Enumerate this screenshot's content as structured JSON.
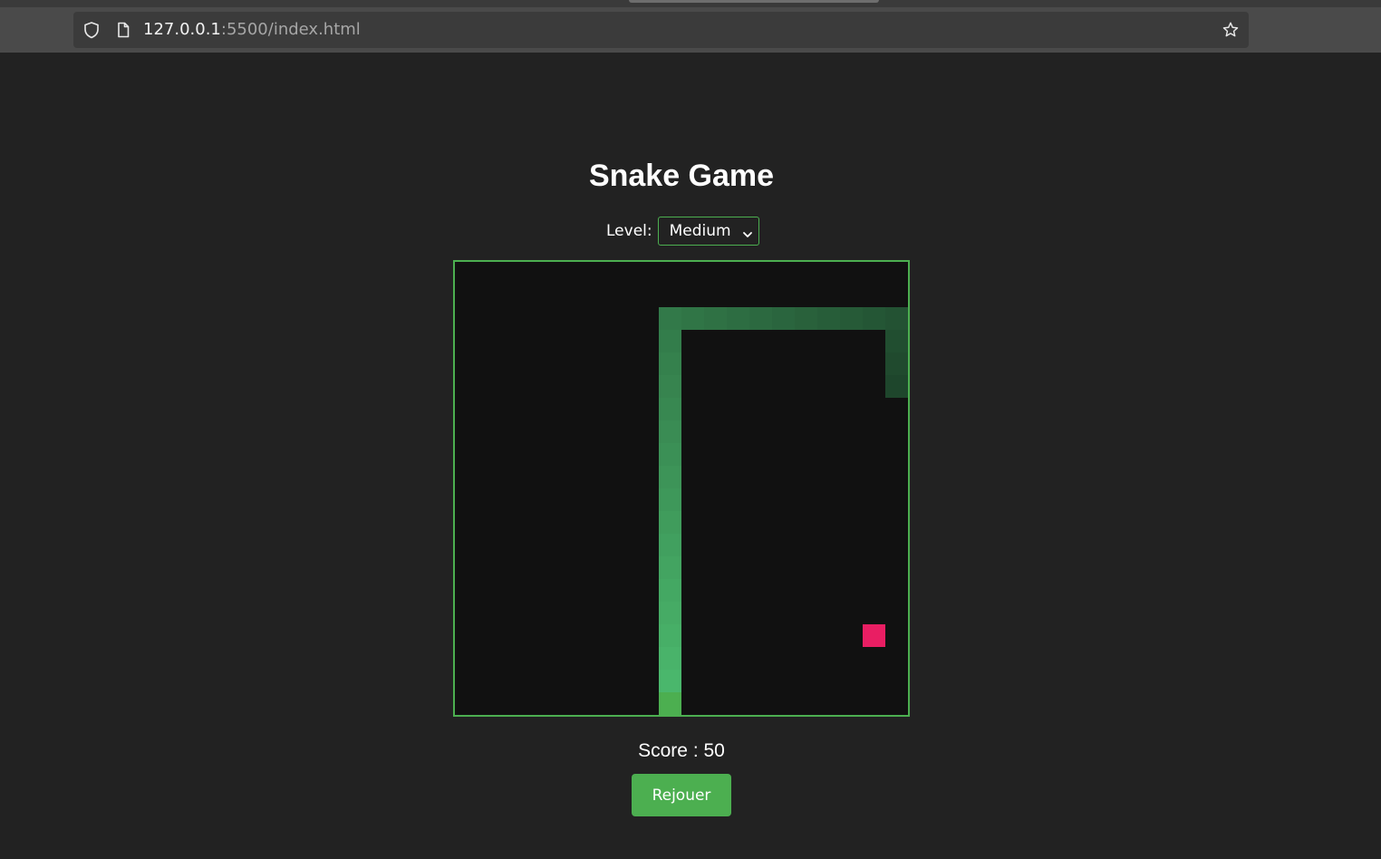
{
  "browser": {
    "url_host": "127.0.0.1",
    "url_rest": ":5500/index.html"
  },
  "game": {
    "title": "Snake Game",
    "level_label": "Level:",
    "level_value": "Medium",
    "score_text": "Score : 50",
    "replay_label": "Rejouer",
    "grid_size": 20,
    "snake": [
      [
        9,
        19
      ],
      [
        9,
        18
      ],
      [
        9,
        17
      ],
      [
        9,
        16
      ],
      [
        9,
        15
      ],
      [
        9,
        14
      ],
      [
        9,
        13
      ],
      [
        9,
        12
      ],
      [
        9,
        11
      ],
      [
        9,
        10
      ],
      [
        9,
        9
      ],
      [
        9,
        8
      ],
      [
        9,
        7
      ],
      [
        9,
        6
      ],
      [
        9,
        5
      ],
      [
        9,
        4
      ],
      [
        9,
        3
      ],
      [
        9,
        2
      ],
      [
        10,
        2
      ],
      [
        11,
        2
      ],
      [
        12,
        2
      ],
      [
        13,
        2
      ],
      [
        14,
        2
      ],
      [
        15,
        2
      ],
      [
        16,
        2
      ],
      [
        17,
        2
      ],
      [
        18,
        2
      ],
      [
        19,
        2
      ],
      [
        19,
        3
      ],
      [
        19,
        4
      ],
      [
        19,
        5
      ]
    ],
    "food": [
      18,
      16
    ],
    "colors": {
      "border": "#4caf50",
      "background": "#111111",
      "head": "#4caf50",
      "food": "#e91e63"
    }
  }
}
